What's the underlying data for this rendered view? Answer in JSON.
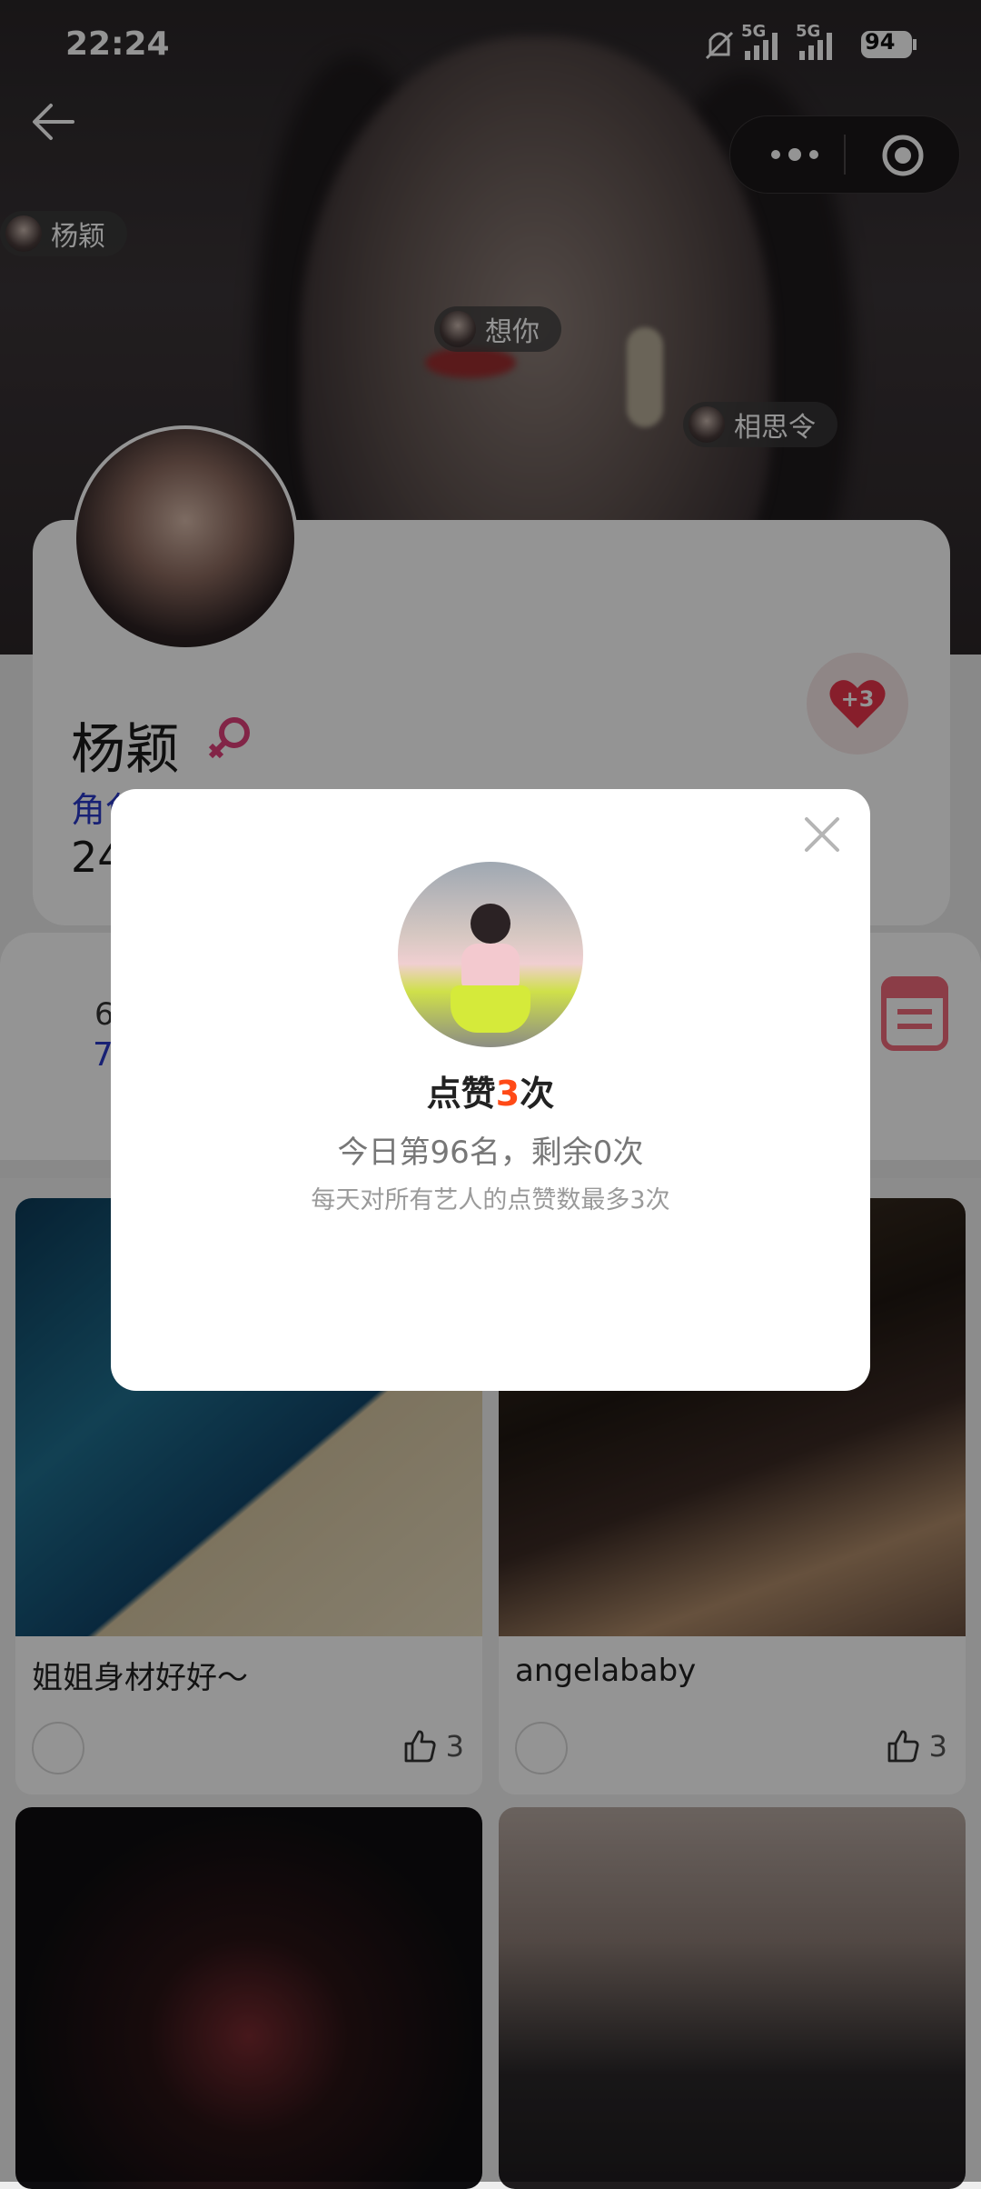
{
  "status_bar": {
    "time": "22:24",
    "signal_1": "5G",
    "signal_2": "5G",
    "battery": "94"
  },
  "danmaku": [
    "杨颖",
    "想你",
    "相思令"
  ],
  "profile": {
    "name": "杨颖",
    "role_partial": "角色",
    "age_partial": "24",
    "like_badge": "+3"
  },
  "stats": {
    "label_partial": "6",
    "value_partial": "7."
  },
  "posts": [
    {
      "title": "姐姐身材好好～",
      "likes": "3"
    },
    {
      "title": "angelababy",
      "likes": "3"
    },
    {
      "title": "",
      "likes": ""
    },
    {
      "title": "",
      "likes": ""
    }
  ],
  "dialog": {
    "title_prefix": "点赞",
    "title_count": "3",
    "title_suffix": "次",
    "rank_line": "今日第96名，剩余0次",
    "note": "每天对所有艺人的点赞数最多3次"
  },
  "colors": {
    "accent_red": "#ff4a17",
    "role_blue": "#2a39c9",
    "heart": "#e8344a"
  }
}
